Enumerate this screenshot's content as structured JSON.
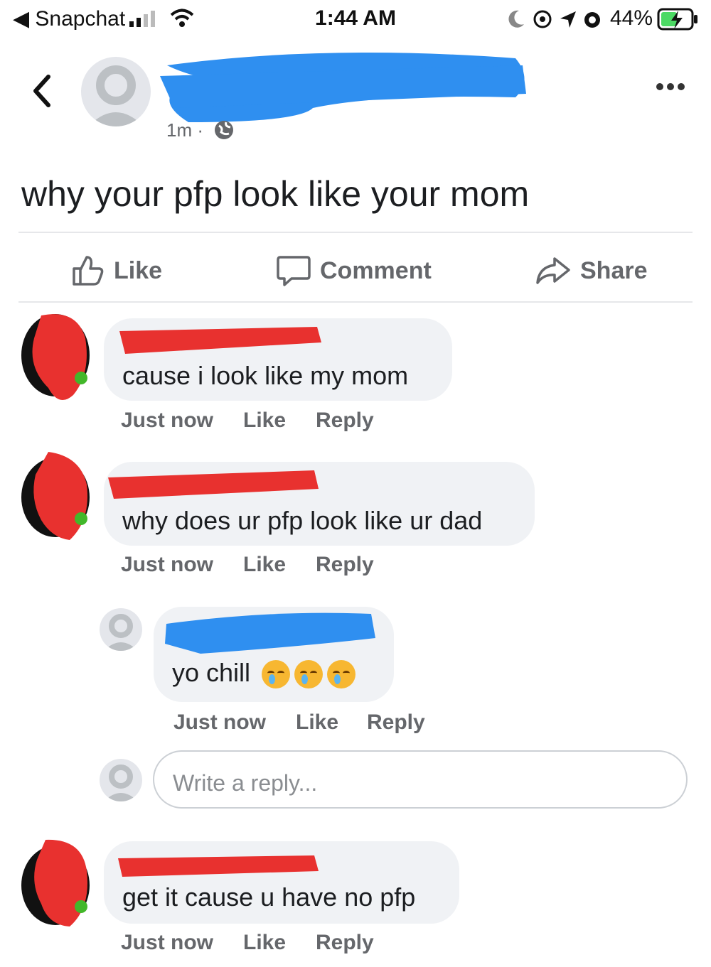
{
  "status_bar": {
    "back_app": "◀ Snapchat",
    "time": "1:44 AM",
    "battery": "44%"
  },
  "post": {
    "time": "1m ·",
    "text": "why your pfp look like your mom"
  },
  "actions": {
    "like": "Like",
    "comment": "Comment",
    "share": "Share"
  },
  "comments": [
    {
      "text": "cause i look like my mom",
      "time": "Just now",
      "like": "Like",
      "reply": "Reply"
    },
    {
      "text": "why does ur pfp look like ur dad",
      "time": "Just now",
      "like": "Like",
      "reply": "Reply"
    },
    {
      "text": "yo chill",
      "time": "Just now",
      "like": "Like",
      "reply": "Reply"
    },
    {
      "text": "get it cause u have no pfp",
      "time": "Just now",
      "like": "Like",
      "reply": "Reply"
    }
  ],
  "reply_box": {
    "placeholder": "Write a reply..."
  },
  "colors": {
    "redaction_blue": "#2f8ff0",
    "redaction_red": "#e8312f",
    "online_green": "#42b72a",
    "meta_gray": "#65676b",
    "bubble_gray": "#f0f2f5"
  },
  "icons": [
    "signal-icon",
    "wifi-icon",
    "moon-icon",
    "location-icon",
    "alarm-icon",
    "battery-icon",
    "back-chevron-icon",
    "more-icon",
    "globe-icon",
    "like-icon",
    "comment-icon",
    "share-icon",
    "emoji-icon"
  ]
}
